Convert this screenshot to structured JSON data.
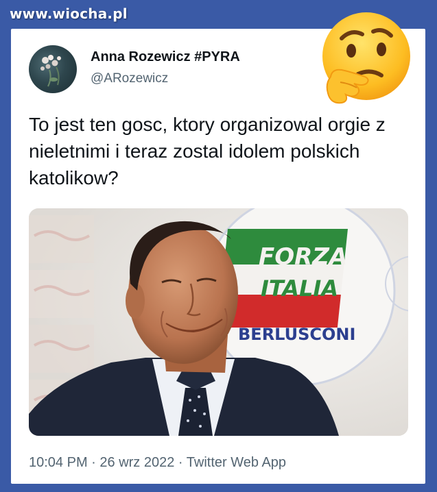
{
  "watermark": "www.wiocha.pl",
  "tweet": {
    "author_name": "Anna Rozewicz #PYRA",
    "author_handle": "@ARozewicz",
    "text": "To jest ten gosc, ktory organizowal orgie z nieletnimi i teraz zostal idolem polskich katolikow?",
    "time": "10:04 PM",
    "separator": " · ",
    "date": "26 wrz 2022",
    "source": "Twitter Web App"
  },
  "photo": {
    "logo_line1": "FORZA",
    "logo_line2": "ITALIA",
    "logo_line3": "BERLUSCONI",
    "logo_colors": {
      "green": "#2e8b3d",
      "red": "#d12b2b",
      "blue": "#2c3f8f"
    }
  },
  "icons": {
    "emoji": "thinking-face-icon"
  }
}
